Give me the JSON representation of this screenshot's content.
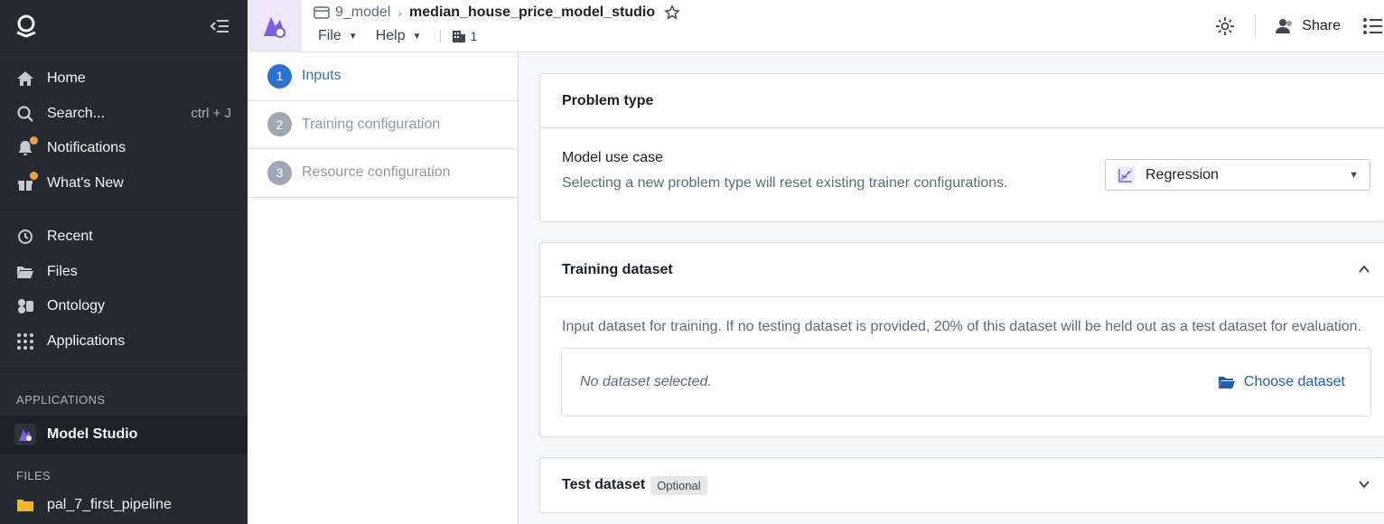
{
  "sidebar": {
    "nav": [
      {
        "label": "Home",
        "icon": "home-icon"
      },
      {
        "label": "Search...",
        "icon": "search-icon",
        "shortcut": "ctrl + J"
      },
      {
        "label": "Notifications",
        "icon": "bell-icon"
      },
      {
        "label": "What's New",
        "icon": "gift-icon"
      }
    ],
    "nav2": [
      {
        "label": "Recent",
        "icon": "history-icon"
      },
      {
        "label": "Files",
        "icon": "folder-icon"
      },
      {
        "label": "Ontology",
        "icon": "cube-icon"
      },
      {
        "label": "Applications",
        "icon": "grid-icon"
      }
    ],
    "apps_heading": "APPLICATIONS",
    "active_app": "Model Studio",
    "files_heading": "FILES",
    "file_item": "pal_7_first_pipeline"
  },
  "topbar": {
    "folder": "9_model",
    "title": "median_house_price_model_studio",
    "menu_file": "File",
    "menu_help": "Help",
    "branch_count": "1",
    "share": "Share"
  },
  "steps": [
    {
      "num": "1",
      "label": "Inputs"
    },
    {
      "num": "2",
      "label": "Training configuration"
    },
    {
      "num": "3",
      "label": "Resource configuration"
    }
  ],
  "problem_type": {
    "header": "Problem type",
    "label": "Model use case",
    "help": "Selecting a new problem type will reset existing trainer configurations.",
    "selected": "Regression"
  },
  "training_dataset": {
    "header": "Training dataset",
    "desc": "Input dataset for training. If no testing dataset is provided, 20% of this dataset will be held out as a test dataset for evaluation.",
    "empty": "No dataset selected.",
    "choose": "Choose dataset"
  },
  "test_dataset": {
    "header": "Test dataset",
    "tag": "Optional"
  },
  "colors": {
    "accent": "#2d72d2",
    "sidebar_bg": "#252a31",
    "notification_dot": "#f0a03c",
    "model_studio_purple": "#7961db"
  }
}
